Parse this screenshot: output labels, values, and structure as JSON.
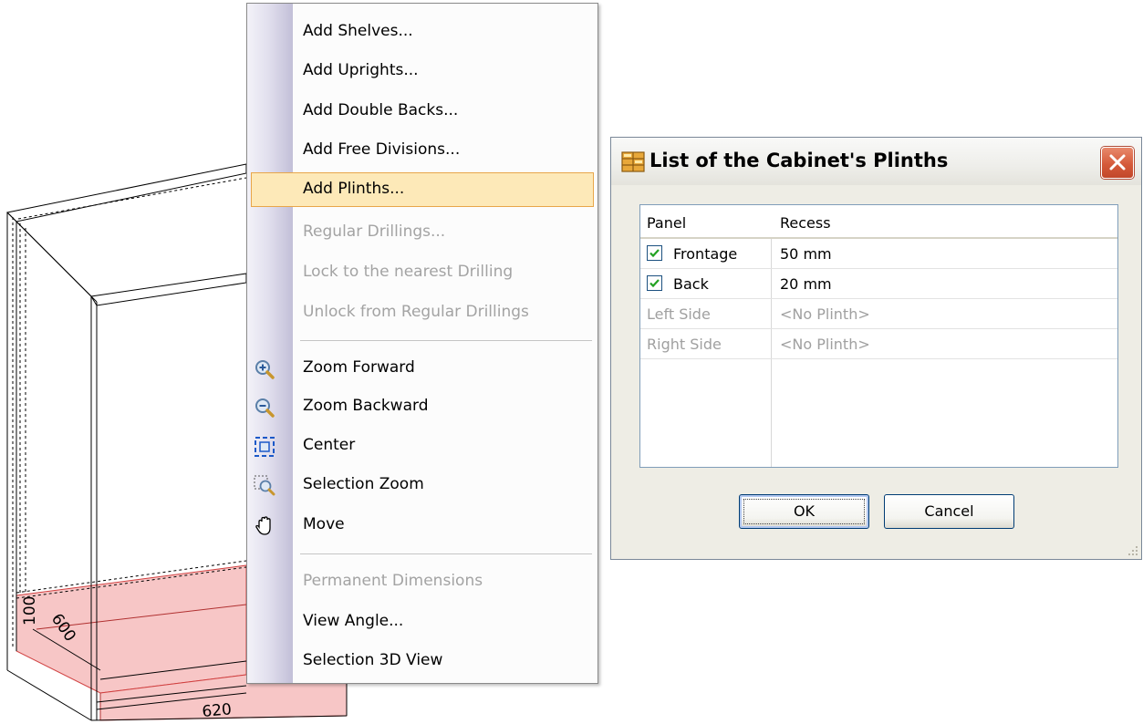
{
  "cabinet": {
    "dim_height": "100",
    "dim_depth": "600",
    "dim_width": "620"
  },
  "context_menu": {
    "items": [
      {
        "label": "Add Shelves..."
      },
      {
        "label": "Add Uprights..."
      },
      {
        "label": "Add Double Backs..."
      },
      {
        "label": "Add Free Divisions..."
      },
      {
        "label": "Add Plinths...",
        "state": "selected"
      },
      {
        "label": "Regular Drillings...",
        "state": "disabled"
      },
      {
        "label": "Lock to the nearest Drilling",
        "state": "disabled"
      },
      {
        "label": "Unlock from Regular Drillings",
        "state": "disabled"
      },
      {
        "label": "Zoom Forward",
        "icon": "zoom-in-icon"
      },
      {
        "label": "Zoom Backward",
        "icon": "zoom-out-icon"
      },
      {
        "label": "Center",
        "icon": "center-view-icon"
      },
      {
        "label": "Selection Zoom",
        "icon": "selection-zoom-icon"
      },
      {
        "label": "Move",
        "icon": "hand-pan-icon"
      },
      {
        "label": "Permanent Dimensions",
        "state": "disabled"
      },
      {
        "label": "View Angle..."
      },
      {
        "label": "Selection 3D View"
      }
    ]
  },
  "dialog": {
    "title": "List of the Cabinet's Plinths",
    "icon": "cabinet-icon",
    "close_icon": "close-icon",
    "columns": [
      "Panel",
      "Recess"
    ],
    "rows": [
      {
        "panel": "Frontage",
        "recess": "50 mm",
        "checked": true
      },
      {
        "panel": "Back",
        "recess": "20 mm",
        "checked": true
      },
      {
        "panel": "Left Side",
        "recess": "<No Plinth>",
        "disabled": true
      },
      {
        "panel": "Right Side",
        "recess": "<No Plinth>",
        "disabled": true
      }
    ],
    "ok_label": "OK",
    "cancel_label": "Cancel"
  },
  "colors": {
    "selected_item_bg": "#fde9b8",
    "selected_item_border": "#e8a64a",
    "plinth_fill": "#f7c6c6",
    "close_button": "#d55a3a"
  }
}
